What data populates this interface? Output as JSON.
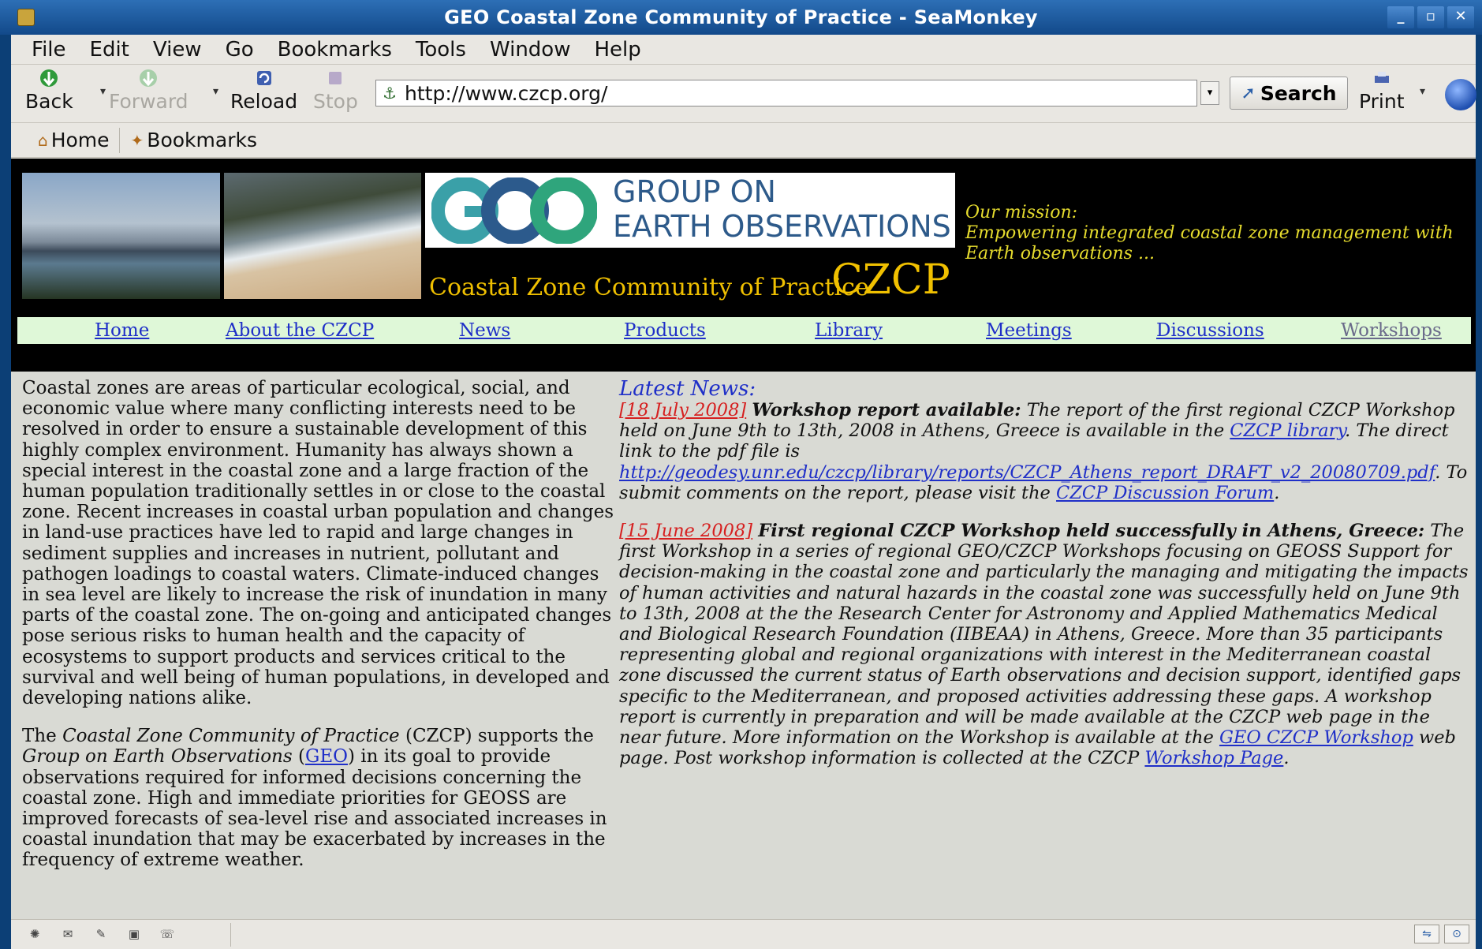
{
  "window": {
    "title": "GEO Coastal Zone Community of Practice - SeaMonkey",
    "controls": [
      "_",
      "▫",
      "✕"
    ]
  },
  "menu": [
    "File",
    "Edit",
    "View",
    "Go",
    "Bookmarks",
    "Tools",
    "Window",
    "Help"
  ],
  "toolbar": {
    "back": "Back",
    "forward": "Forward",
    "reload": "Reload",
    "stop": "Stop",
    "url": "http://www.czcp.org/",
    "search": "Search",
    "print": "Print"
  },
  "personal_bar": {
    "home": "Home",
    "bookmarks": "Bookmarks"
  },
  "banner": {
    "geo_line1": "GROUP ON",
    "geo_line2": "EARTH OBSERVATIONS",
    "czcp_subtitle": "Coastal Zone Community of Practice",
    "czcp_abbrev": "CZCP",
    "mission_label": "Our mission:",
    "mission_text": "Empowering integrated coastal zone management with Earth observations ..."
  },
  "nav": [
    "Home",
    "About the CZCP",
    "News",
    "Products",
    "Library",
    "Meetings",
    "Discussions",
    "Workshops"
  ],
  "left": {
    "p1": "Coastal zones are areas of particular ecological, social, and economic value where many conflicting interests need to be resolved in order to ensure a sustainable development of this highly complex environment. Humanity has always shown a special interest in the coastal zone and a large fraction of the human population traditionally settles in or close to the coastal zone. Recent increases in coastal urban population and changes in land-use practices have led to rapid and large changes in sediment supplies and increases in nutrient, pollutant and pathogen loadings to coastal waters. Climate-induced changes in sea level are likely to increase the risk of inundation in many parts of the coastal zone. The on-going and anticipated changes pose serious risks to human health and the capacity of ecosystems to support products and services critical to the survival and well being of human populations, in developed and developing nations alike.",
    "p2_pre": "The ",
    "p2_italic": "Coastal Zone Community of Practice",
    "p2_mid": " (CZCP) supports the ",
    "p2_italic2": "Group on Earth Observations",
    "p2_paren_open": " (",
    "p2_geo_link": "GEO",
    "p2_rest": ") in its goal to provide observations required for informed decisions concerning the coastal zone. High and immediate priorities for GEOSS are improved forecasts of sea-level rise and associated increases in coastal inundation that may be exacerbated by increases in the frequency of extreme weather."
  },
  "news": {
    "heading": "Latest News:",
    "item1": {
      "date": "[18 July 2008]",
      "title": "Workshop report available:",
      "t1": " The report of the first regional CZCP Workshop held on June 9th to 13th, 2008 in Athens, Greece is available in the ",
      "link1": "CZCP library",
      "t2": ". The direct link to the pdf file is ",
      "link2": "http://geodesy.unr.edu/czcp/library/reports/CZCP_Athens_report_DRAFT_v2_20080709.pdf",
      "t3": ". To submit comments on the report, please visit the ",
      "link3": "CZCP Discussion Forum",
      "t4": "."
    },
    "item2": {
      "date": "[15 June 2008]",
      "title": "First regional CZCP Workshop held successfully in Athens, Greece:",
      "t1": " The first Workshop in a series of regional GEO/CZCP Workshops focusing on GEOSS Support for decision-making in the coastal zone and particularly the managing and mitigating the impacts of human activities and natural hazards in the coastal zone was successfully held on June 9th to 13th, 2008 at the the Research Center for Astronomy and Applied Mathematics Medical and Biological Research Foundation (IIBEAA) in Athens, Greece. More than 35 participants representing global and regional organizations with interest in the Mediterranean coastal zone discussed the current status of Earth observations and decision support, identified gaps specific to the Mediterranean, and proposed activities addressing these gaps. A workshop report is currently in preparation and will be made available at the CZCP web page in the near future. More information on the Workshop is available at the ",
      "link1": "GEO CZCP Workshop",
      "t2": " web page. Post workshop information is collected at the CZCP ",
      "link2": "Workshop Page",
      "t3": "."
    }
  }
}
